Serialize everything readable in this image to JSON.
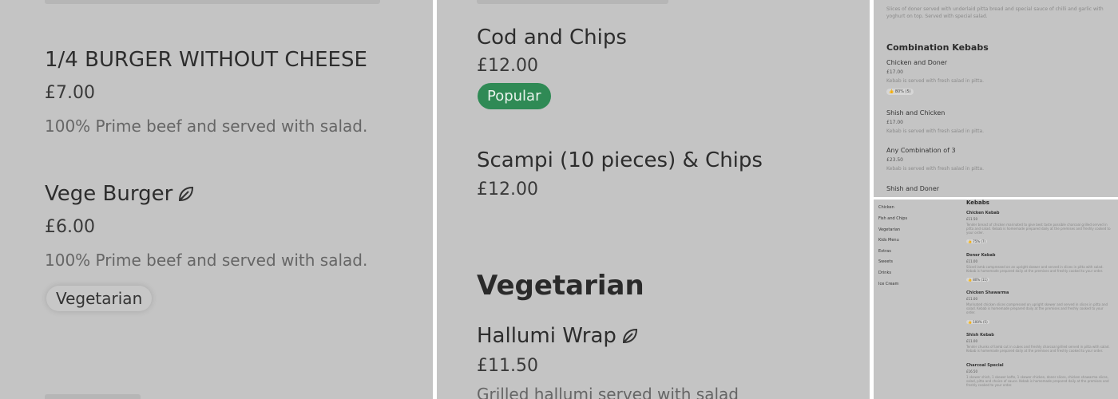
{
  "panel1": {
    "items": [
      {
        "name": "1/4 BURGER WITHOUT CHEESE",
        "price": "£7.00",
        "desc": "100% Prime beef and served with salad."
      },
      {
        "name": "Vege Burger",
        "price": "£6.00",
        "desc": "100% Prime beef and served with salad.",
        "tag": "Vegetarian",
        "icon": "leaf-icon"
      }
    ]
  },
  "panel2": {
    "items": [
      {
        "name": "Cod and Chips",
        "price": "£12.00",
        "badge": "Popular"
      },
      {
        "name": "Scampi (10 pieces) & Chips",
        "price": "£12.00"
      }
    ],
    "section": "Vegetarian",
    "section_items": [
      {
        "name": "Hallumi Wrap",
        "price": "£11.50",
        "desc": "Grilled hallumi served with salad",
        "icon": "leaf-icon"
      }
    ]
  },
  "panel3": {
    "top_desc": "Slices of doner served with underlaid pitta bread and special sauce of chilli and garlic with yoghurt on top. Served with special salad.",
    "section": "Combination Kebabs",
    "items": [
      {
        "name": "Chicken and Doner",
        "price": "£17.00",
        "desc": "Kebab is served with fresh salad in pitta.",
        "rating": "80% (5)"
      },
      {
        "name": "Shish and Chicken",
        "price": "£17.00",
        "desc": "Kebab is served with fresh salad in pitta."
      },
      {
        "name": "Any Combination of 3",
        "price": "£23.50",
        "desc": "Kebab is served with fresh salad in pitta."
      },
      {
        "name": "Shish and Doner"
      }
    ]
  },
  "panel4": {
    "sidebar": [
      "Chicken",
      "Fish and Chips",
      "Vegetarian",
      "Kids Menu",
      "Extras",
      "Sweets",
      "Drinks",
      "Ice Cream"
    ],
    "section": "Kebabs",
    "items": [
      {
        "name": "Chicken Kebab",
        "price": "£11.50",
        "desc": "Tender breast of chicken marinated to give best taste possible charcoal grilled served in pitta and salad. Kebab is homemade prepared daily at the premises and freshly cooked to your order.",
        "rating": "75% (7)"
      },
      {
        "name": "Doner Kebab",
        "price": "£11.00",
        "desc": "Sliced lamb compressed on an upright skewer and served in slices in pitta with salad. Kebab is homemade prepared daily at the premises and freshly cooked to your order.",
        "rating": "80% (11)"
      },
      {
        "name": "Chicken Shawarma",
        "price": "£11.00",
        "desc": "Marinated chicken slices compressed on upright skewer and served in slices in pitta and salad. Kebab is homemade prepared daily at the premises and freshly cooked to your order.",
        "rating": "100% (5)"
      },
      {
        "name": "Shish Kebab",
        "price": "£11.00",
        "desc": "Tender chunks of lamb cut in cubes and freshly charcoal grilled served in pitta with salad. Kebab is homemade prepared daily at the premises and freshly cooked to your order."
      },
      {
        "name": "Charcoal Special",
        "price": "£16.50",
        "desc": "1 skewer shish, 1 skewer kofte, 1 skewer chicken, doner slices, chicken shawarma slices, salad, pitta and choice of sauce. Kebab is homemade prepared daily at the premises and freshly cooked to your order."
      }
    ]
  },
  "colors": {
    "panel_bg": "#c4c4c4",
    "popular_green": "#2f8a55"
  }
}
